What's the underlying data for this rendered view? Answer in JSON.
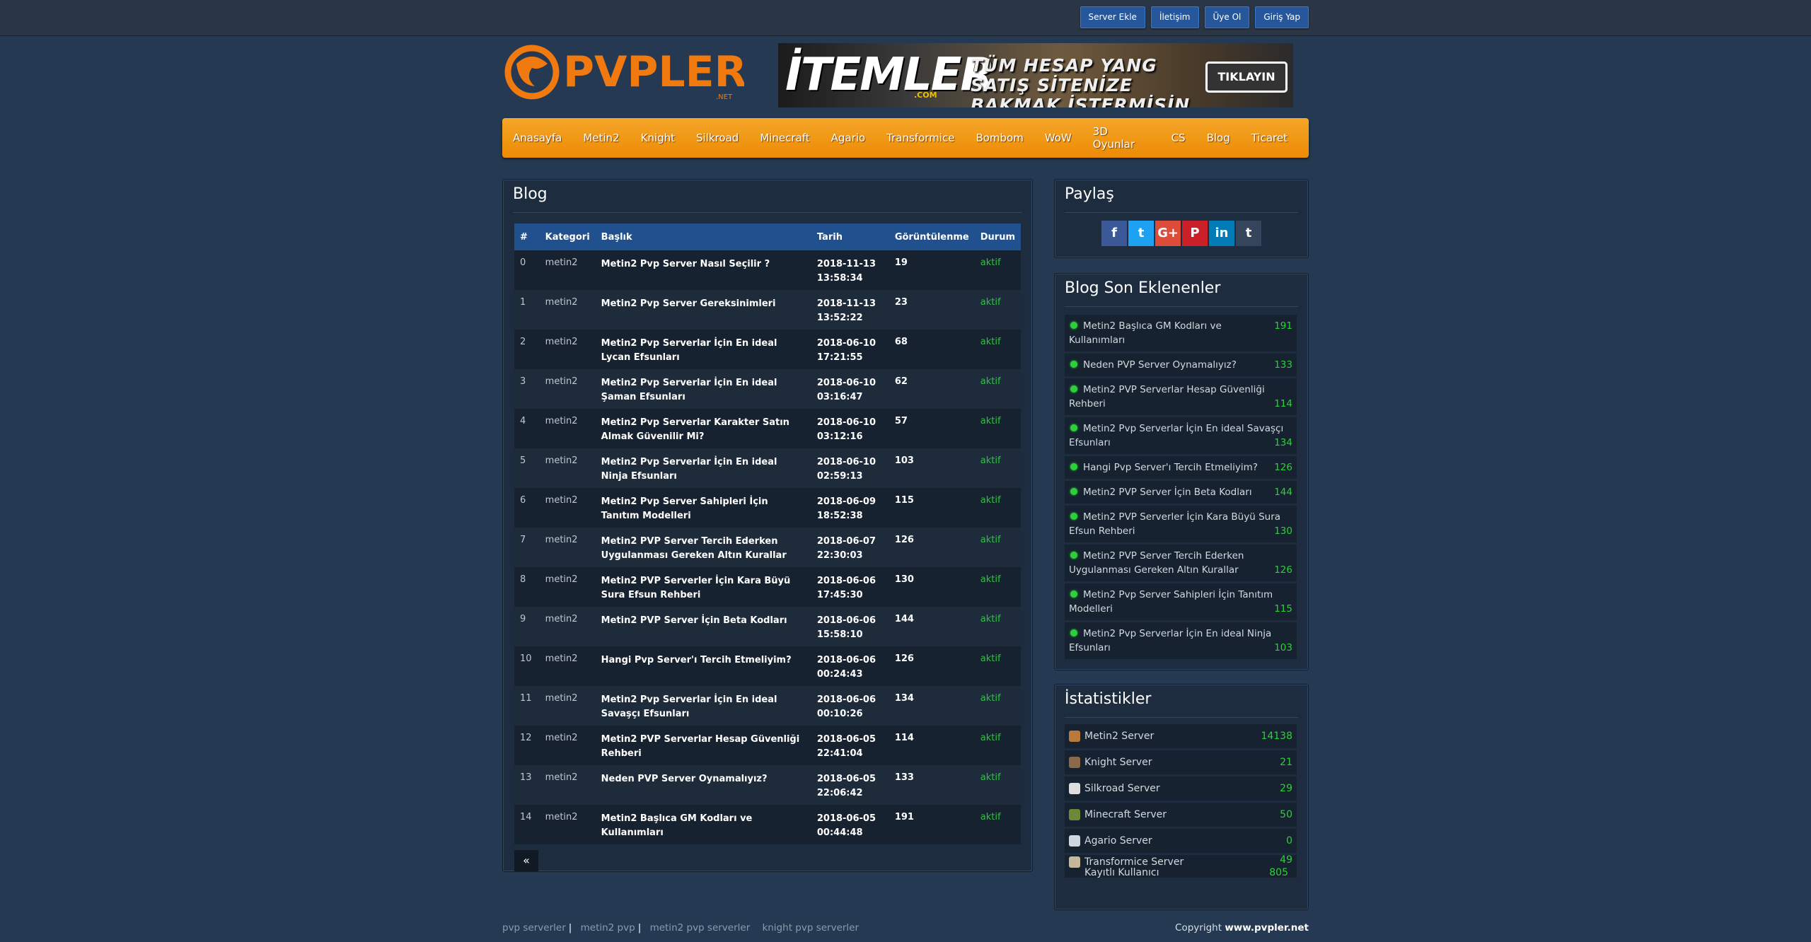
{
  "topbar": {
    "buttons": [
      "Server Ekle",
      "İletişim",
      "Üye Ol",
      "Giriş Yap"
    ]
  },
  "logo": {
    "text": "PVPLER",
    "sub": ".NET"
  },
  "banner": {
    "brand": "İTEMLER",
    "brand_sub": ".COM",
    "slogan": "TÜM HESAP YANG SATIŞ SİTENİZE BAKMAK İSTERMİSİN",
    "button": "TIKLAYIN"
  },
  "nav": [
    "Anasayfa",
    "Metin2",
    "Knight",
    "Silkroad",
    "Minecraft",
    "Agario",
    "Transformice",
    "Bombom",
    "WoW",
    "3D Oyunlar",
    "CS",
    "Blog",
    "Ticaret"
  ],
  "blog": {
    "title": "Blog",
    "columns": [
      "#",
      "Kategori",
      "Başlık",
      "Tarih",
      "Görüntülenme",
      "Durum"
    ],
    "rows": [
      [
        "0",
        "metin2",
        "Metin2 Pvp Server Nasıl Seçilir ?",
        "2018-11-13 13:58:34",
        "19",
        "aktif"
      ],
      [
        "1",
        "metin2",
        "Metin2 Pvp Server Gereksinimleri",
        "2018-11-13 13:52:22",
        "23",
        "aktif"
      ],
      [
        "2",
        "metin2",
        "Metin2 Pvp Serverlar İçin En ideal Lycan Efsunları",
        "2018-06-10 17:21:55",
        "68",
        "aktif"
      ],
      [
        "3",
        "metin2",
        "Metin2 Pvp Serverlar İçin En ideal Şaman Efsunları",
        "2018-06-10 03:16:47",
        "62",
        "aktif"
      ],
      [
        "4",
        "metin2",
        "Metin2 Pvp Serverlar Karakter Satın Almak Güvenilir Mi?",
        "2018-06-10 03:12:16",
        "57",
        "aktif"
      ],
      [
        "5",
        "metin2",
        "Metin2 Pvp Serverlar İçin En ideal Ninja Efsunları",
        "2018-06-10 02:59:13",
        "103",
        "aktif"
      ],
      [
        "6",
        "metin2",
        "Metin2 Pvp Server Sahipleri İçin Tanıtım Modelleri",
        "2018-06-09 18:52:38",
        "115",
        "aktif"
      ],
      [
        "7",
        "metin2",
        "Metin2  PVP Server Tercih Ederken Uygulanması Gereken Altın Kurallar",
        "2018-06-07 22:30:03",
        "126",
        "aktif"
      ],
      [
        "8",
        "metin2",
        "Metin2 PVP Serverler İçin Kara Büyü Sura Efsun Rehberi",
        "2018-06-06 17:45:30",
        "130",
        "aktif"
      ],
      [
        "9",
        "metin2",
        "Metin2 PVP Server İçin Beta Kodları",
        "2018-06-06 15:58:10",
        "144",
        "aktif"
      ],
      [
        "10",
        "metin2",
        "Hangi Pvp Server'ı Tercih Etmeliyim?",
        "2018-06-06 00:24:43",
        "126",
        "aktif"
      ],
      [
        "11",
        "metin2",
        "Metin2 Pvp Serverlar İçin En ideal Savaşçı Efsunları",
        "2018-06-06 00:10:26",
        "134",
        "aktif"
      ],
      [
        "12",
        "metin2",
        "Metin2 PVP Serverlar Hesap Güvenliği Rehberi",
        "2018-06-05 22:41:04",
        "114",
        "aktif"
      ],
      [
        "13",
        "metin2",
        "Neden PVP Server Oynamalıyız?",
        "2018-06-05 22:06:42",
        "133",
        "aktif"
      ],
      [
        "14",
        "metin2",
        "Metin2 Başlıca GM Kodları ve Kullanımları",
        "2018-06-05 00:44:48",
        "191",
        "aktif"
      ]
    ],
    "pager": "«"
  },
  "share": {
    "title": "Paylaş",
    "buttons": [
      {
        "icon": "facebook-icon",
        "glyph": "f",
        "color": "#3b5998"
      },
      {
        "icon": "twitter-icon",
        "glyph": "t",
        "color": "#1da1f2"
      },
      {
        "icon": "google-plus-icon",
        "glyph": "G+",
        "color": "#dd4b39"
      },
      {
        "icon": "pinterest-icon",
        "glyph": "P",
        "color": "#cb2027"
      },
      {
        "icon": "linkedin-icon",
        "glyph": "in",
        "color": "#007bb6"
      },
      {
        "icon": "tumblr-icon",
        "glyph": "t",
        "color": "#35465c"
      }
    ]
  },
  "recent": {
    "title": "Blog Son Eklenenler",
    "items": [
      {
        "text": "Metin2 Başlıca GM Kodları ve Kullanımları",
        "count": "191"
      },
      {
        "text": "Neden PVP Server Oynamalıyız?",
        "count": "133"
      },
      {
        "text": "Metin2 PVP Serverlar Hesap Güvenliği Rehberi",
        "count": "114"
      },
      {
        "text": "Metin2 Pvp Serverlar İçin En ideal Savaşçı Efsunları",
        "count": "134"
      },
      {
        "text": "Hangi Pvp Server'ı Tercih Etmeliyim?",
        "count": "126"
      },
      {
        "text": "Metin2 PVP Server İçin Beta Kodları",
        "count": "144"
      },
      {
        "text": "Metin2 PVP Serverler İçin Kara Büyü Sura Efsun Rehberi",
        "count": "130"
      },
      {
        "text": "Metin2  PVP Server Tercih Ederken Uygulanması Gereken Altın Kurallar",
        "count": "126"
      },
      {
        "text": "Metin2 Pvp Server Sahipleri İçin Tanıtım Modelleri",
        "count": "115"
      },
      {
        "text": "Metin2 Pvp Serverlar İçin En ideal Ninja Efsunları",
        "count": "103"
      }
    ]
  },
  "stats": {
    "title": "İstatistikler",
    "items": [
      {
        "label": "Metin2 Server",
        "count": "14138",
        "icon": "metin2-icon",
        "color": "#b87a3a"
      },
      {
        "label": "Knight Server",
        "count": "21",
        "icon": "knight-icon",
        "color": "#8a6a4a"
      },
      {
        "label": "Silkroad Server",
        "count": "29",
        "icon": "silkroad-icon",
        "color": "#dddddd"
      },
      {
        "label": "Minecraft Server",
        "count": "50",
        "icon": "minecraft-icon",
        "color": "#6a8a3a"
      },
      {
        "label": "Agario Server",
        "count": "0",
        "icon": "agario-icon",
        "color": "#cfd8e0"
      },
      {
        "label": "Transformice Server",
        "count": "49",
        "icon": "transformice-icon",
        "color": "#c8b89a"
      }
    ],
    "users_label": "Kayıtlı Kullanıcı",
    "users_count": "805"
  },
  "footer": {
    "links": [
      "pvp serverler",
      "metin2 pvp",
      "metin2 pvp serverler",
      "knight pvp serverler"
    ],
    "copyright_prefix": "Copyright",
    "copyright_site": "www.pvpler.net"
  }
}
